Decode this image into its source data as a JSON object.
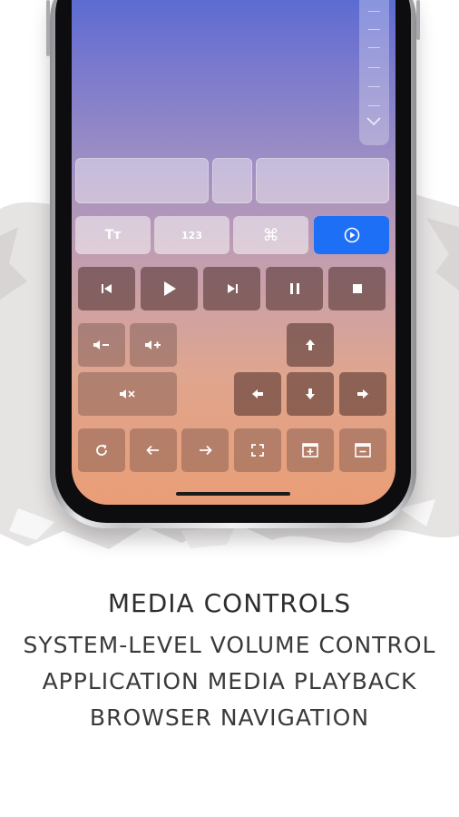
{
  "colors": {
    "accent": "#1d6ff5",
    "screen_top": "#4a65d4",
    "screen_bottom": "#ea9e76",
    "caption_text": "#3a3a3a"
  },
  "mode_bar": {
    "text_mode": {
      "label": "Tт",
      "icon": "text-size-icon"
    },
    "numeric_mode": {
      "label": "123"
    },
    "command_mode": {
      "label": "⌘",
      "icon": "command-icon"
    },
    "media_mode": {
      "icon": "play-circle-icon",
      "selected": true
    }
  },
  "media_keys": [
    {
      "name": "previous-track-button",
      "glyph": "⏮",
      "icon": "skip-previous-icon"
    },
    {
      "name": "play-button",
      "glyph": "▶",
      "icon": "play-icon"
    },
    {
      "name": "next-track-button",
      "glyph": "⏭",
      "icon": "skip-next-icon"
    },
    {
      "name": "pause-button",
      "glyph": "❚❚",
      "icon": "pause-icon"
    },
    {
      "name": "stop-button",
      "glyph": "■",
      "icon": "stop-icon"
    }
  ],
  "volume_keys": {
    "down": {
      "glyph": "🔉−",
      "icon": "volume-down-icon"
    },
    "up": {
      "glyph": "🔊+",
      "icon": "volume-up-icon"
    },
    "mute": {
      "glyph": "🔇",
      "icon": "volume-mute-icon"
    }
  },
  "arrow_keys": {
    "up": "⬆",
    "left": "⬅",
    "down": "⬇",
    "right": "➡"
  },
  "browser_keys": [
    {
      "name": "reload-button",
      "glyph": "↻",
      "icon": "reload-icon"
    },
    {
      "name": "back-button",
      "glyph": "←",
      "icon": "arrow-left-icon"
    },
    {
      "name": "forward-button",
      "glyph": "→",
      "icon": "arrow-right-icon"
    },
    {
      "name": "fullscreen-button",
      "glyph": "⛶",
      "icon": "fullscreen-icon"
    },
    {
      "name": "new-tab-button",
      "glyph": "⊞",
      "icon": "add-tab-icon"
    },
    {
      "name": "close-tab-button",
      "glyph": "⊟",
      "icon": "remove-tab-icon"
    }
  ],
  "caption": {
    "title": "Media Controls",
    "line1": "System-level volume control",
    "line2": "Application media playback",
    "line3": "Browser navigation"
  }
}
